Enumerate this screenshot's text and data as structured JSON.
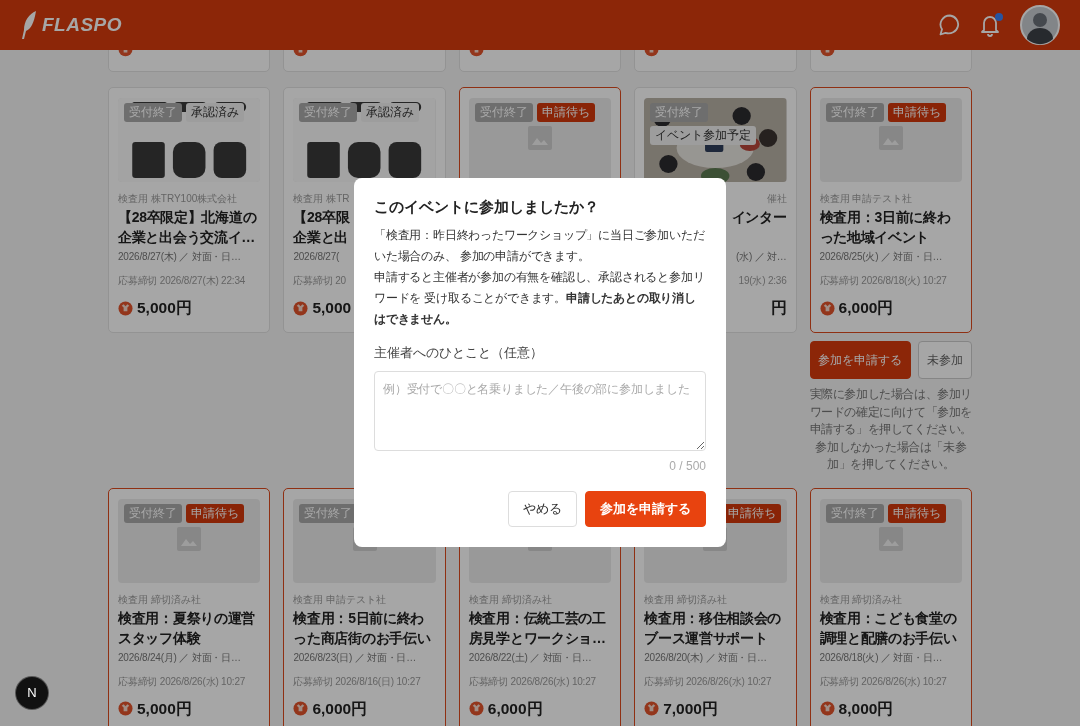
{
  "header": {
    "logo": "FLASPO",
    "notification_dot": true
  },
  "event_rows": [
    [
      {
        "kind": "stub",
        "highlighted": false
      },
      {
        "kind": "stub",
        "highlighted": false
      },
      {
        "kind": "stub",
        "highlighted": false
      },
      {
        "kind": "stub",
        "highlighted": false
      },
      {
        "kind": "stub",
        "highlighted": false
      }
    ],
    [
      {
        "kind": "event",
        "highlighted": false,
        "image": {
          "kind": "picture"
        },
        "badges": [
          {
            "text": "受付終了",
            "kind": "closed"
          },
          {
            "text": "承認済み",
            "kind": "approved"
          }
        ],
        "company": "検査用 株TRY100株式会社",
        "title": "【28卒限定】北海道の企業と出会う交流イ…",
        "date": "2026/8/27(木) ／ 対面・日…",
        "deadline": "応募締切 2026/8/27(木) 22:34",
        "price": "5,000円"
      },
      {
        "kind": "event",
        "highlighted": false,
        "image": {
          "kind": "picture"
        },
        "badges": [
          {
            "text": "受付終了",
            "kind": "closed"
          },
          {
            "text": "承認済み",
            "kind": "approved"
          }
        ],
        "company": "検査用 株TR",
        "title_lines": [
          "【28卒限",
          "企業と出"
        ],
        "date": "2026/8/27(",
        "deadline": "応募締切 20",
        "price": "5,000"
      },
      {
        "kind": "event",
        "highlighted": true,
        "image": {
          "kind": "placeholder"
        },
        "badges": [
          {
            "text": "受付終了",
            "kind": "closed"
          },
          {
            "text": "申請待ち",
            "kind": "pending"
          }
        ]
      },
      {
        "kind": "event",
        "highlighted": false,
        "text_shifted": true,
        "image": {
          "kind": "picture"
        },
        "badges": [
          {
            "text": "受付終了",
            "kind": "closed"
          },
          {
            "text": "イベント参加予定",
            "kind": "planned"
          }
        ],
        "company": "催社",
        "title": "インター",
        "date": "(水) ／ 対…",
        "deadline": "19(水) 2:36",
        "price": "円"
      },
      {
        "kind": "event",
        "highlighted": true,
        "image": {
          "kind": "placeholder"
        },
        "badges": [
          {
            "text": "受付終了",
            "kind": "closed"
          },
          {
            "text": "申請待ち",
            "kind": "pending"
          }
        ],
        "company": "検査用 申請テスト社",
        "title": "検査用：3日前に終わった地域イベント",
        "date": "2026/8/25(火) ／ 対面・日…",
        "deadline": "応募締切 2026/8/18(火) 10:27",
        "price": "6,000円",
        "actions": {
          "buttons": [
            {
              "label": "参加を申請する",
              "kind": "primary"
            },
            {
              "label": "未参加",
              "kind": "secondary"
            }
          ],
          "note": "実際に参加した場合は、参加リワードの確定に向けて「参加を申請する」を押してください。参加しなかった場合は「未参加」を押してください。"
        }
      }
    ],
    [
      {
        "kind": "event",
        "highlighted": true,
        "image": {
          "kind": "placeholder"
        },
        "badges": [
          {
            "text": "受付終了",
            "kind": "closed"
          },
          {
            "text": "申請待ち",
            "kind": "pending"
          }
        ],
        "company": "検査用 締切済み社",
        "title": "検査用：夏祭りの運営スタッフ体験",
        "date": "2026/8/24(月) ／ 対面・日…",
        "deadline": "応募締切 2026/8/26(水) 10:27",
        "price": "5,000円"
      },
      {
        "kind": "event",
        "highlighted": true,
        "image": {
          "kind": "placeholder"
        },
        "badges": [
          {
            "text": "受付終了",
            "kind": "closed"
          }
        ],
        "company": "検査用 申請テスト社",
        "title": "検査用：5日前に終わった商店街のお手伝い",
        "date": "2026/8/23(日) ／ 対面・日…",
        "deadline": "応募締切 2026/8/16(日) 10:27",
        "price": "6,000円"
      },
      {
        "kind": "event",
        "highlighted": true,
        "image": {
          "kind": "placeholder"
        },
        "company": "検査用 締切済み社",
        "title": "検査用：伝統工芸の工房見学とワークショ…",
        "date": "2026/8/22(土) ／ 対面・日…",
        "deadline": "応募締切 2026/8/26(水) 10:27",
        "price": "6,000円"
      },
      {
        "kind": "event",
        "highlighted": true,
        "badges_shifted": true,
        "image": {
          "kind": "placeholder"
        },
        "badges": [
          {
            "text": "申請待ち",
            "kind": "pending"
          }
        ],
        "company": "検査用 締切済み社",
        "title": "検査用：移住相談会のブース運営サポート",
        "date": "2026/8/20(木) ／ 対面・日…",
        "deadline": "応募締切 2026/8/26(水) 10:27",
        "price": "7,000円"
      },
      {
        "kind": "event",
        "highlighted": true,
        "image": {
          "kind": "placeholder"
        },
        "badges": [
          {
            "text": "受付終了",
            "kind": "closed"
          },
          {
            "text": "申請待ち",
            "kind": "pending"
          }
        ],
        "company": "検査用 締切済み社",
        "title": "検査用：こども食堂の調理と配膳のお手伝い",
        "date": "2026/8/18(火) ／ 対面・日…",
        "deadline": "応募締切 2026/8/26(水) 10:27",
        "price": "8,000円"
      }
    ]
  ],
  "dialog": {
    "title": "このイベントに参加しましたか？",
    "paragraphs": [
      "「検査用：昨日終わったワークショップ」に当日ご参加いただいた場合のみ、 参加の申請ができます。",
      "申請すると主催者が参加の有無を確認し、承認されると参加リワードを 受け取ることができます。**申請したあとの取り消しはできません。**"
    ],
    "field_label": "主催者へのひとこと（任意）",
    "placeholder": "例）受付で〇〇と名乗りました／午後の部に参加しました",
    "counter": "0 / 500",
    "buttons": [
      {
        "label": "やめる",
        "kind": "secondary"
      },
      {
        "label": "参加を申請する",
        "kind": "primary"
      }
    ]
  },
  "dev_indicator": "N"
}
